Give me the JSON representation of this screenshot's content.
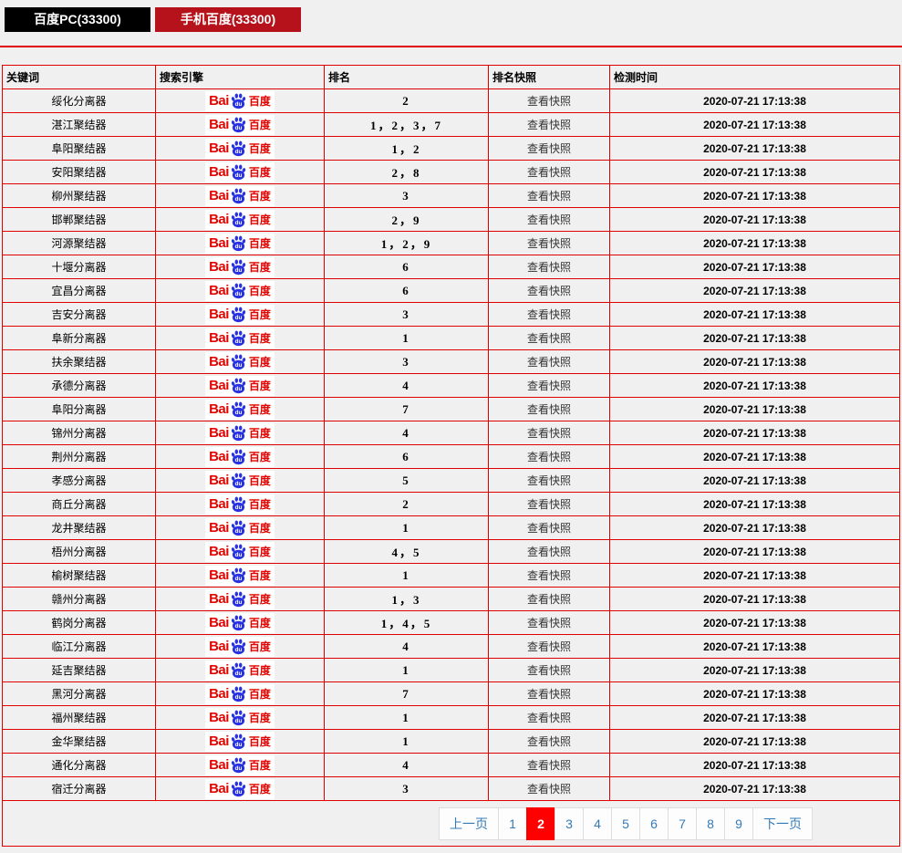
{
  "tabs": [
    {
      "label": "百度PC(33300)"
    },
    {
      "label": "手机百度(33300)"
    }
  ],
  "table": {
    "headers": [
      "关键词",
      "搜索引擎",
      "排名",
      "排名快照",
      "检测时间"
    ],
    "engine_logo": {
      "bai": "Bai",
      "du": "du",
      "cn": "百度"
    },
    "snapshot_label": "查看快照",
    "rows": [
      {
        "keyword": "绥化分离器",
        "rank": "2",
        "time": "2020-07-21 17:13:38"
      },
      {
        "keyword": "湛江聚结器",
        "rank": "1，2，3，7",
        "time": "2020-07-21 17:13:38"
      },
      {
        "keyword": "阜阳聚结器",
        "rank": "1，2",
        "time": "2020-07-21 17:13:38"
      },
      {
        "keyword": "安阳聚结器",
        "rank": "2，8",
        "time": "2020-07-21 17:13:38"
      },
      {
        "keyword": "柳州聚结器",
        "rank": "3",
        "time": "2020-07-21 17:13:38"
      },
      {
        "keyword": "邯郸聚结器",
        "rank": "2，9",
        "time": "2020-07-21 17:13:38"
      },
      {
        "keyword": "河源聚结器",
        "rank": "1，2，9",
        "time": "2020-07-21 17:13:38"
      },
      {
        "keyword": "十堰分离器",
        "rank": "6",
        "time": "2020-07-21 17:13:38"
      },
      {
        "keyword": "宜昌分离器",
        "rank": "6",
        "time": "2020-07-21 17:13:38"
      },
      {
        "keyword": "吉安分离器",
        "rank": "3",
        "time": "2020-07-21 17:13:38"
      },
      {
        "keyword": "阜新分离器",
        "rank": "1",
        "time": "2020-07-21 17:13:38"
      },
      {
        "keyword": "扶余聚结器",
        "rank": "3",
        "time": "2020-07-21 17:13:38"
      },
      {
        "keyword": "承德分离器",
        "rank": "4",
        "time": "2020-07-21 17:13:38"
      },
      {
        "keyword": "阜阳分离器",
        "rank": "7",
        "time": "2020-07-21 17:13:38"
      },
      {
        "keyword": "锦州分离器",
        "rank": "4",
        "time": "2020-07-21 17:13:38"
      },
      {
        "keyword": "荆州分离器",
        "rank": "6",
        "time": "2020-07-21 17:13:38"
      },
      {
        "keyword": "孝感分离器",
        "rank": "5",
        "time": "2020-07-21 17:13:38"
      },
      {
        "keyword": "商丘分离器",
        "rank": "2",
        "time": "2020-07-21 17:13:38"
      },
      {
        "keyword": "龙井聚结器",
        "rank": "1",
        "time": "2020-07-21 17:13:38"
      },
      {
        "keyword": "梧州分离器",
        "rank": "4，5",
        "time": "2020-07-21 17:13:38"
      },
      {
        "keyword": "榆树聚结器",
        "rank": "1",
        "time": "2020-07-21 17:13:38"
      },
      {
        "keyword": "赣州分离器",
        "rank": "1，3",
        "time": "2020-07-21 17:13:38"
      },
      {
        "keyword": "鹤岗分离器",
        "rank": "1，4，5",
        "time": "2020-07-21 17:13:38"
      },
      {
        "keyword": "临江分离器",
        "rank": "4",
        "time": "2020-07-21 17:13:38"
      },
      {
        "keyword": "延吉聚结器",
        "rank": "1",
        "time": "2020-07-21 17:13:38"
      },
      {
        "keyword": "黑河分离器",
        "rank": "7",
        "time": "2020-07-21 17:13:38"
      },
      {
        "keyword": "福州聚结器",
        "rank": "1",
        "time": "2020-07-21 17:13:38"
      },
      {
        "keyword": "金华聚结器",
        "rank": "1",
        "time": "2020-07-21 17:13:38"
      },
      {
        "keyword": "通化分离器",
        "rank": "4",
        "time": "2020-07-21 17:13:38"
      },
      {
        "keyword": "宿迁分离器",
        "rank": "3",
        "time": "2020-07-21 17:13:38"
      }
    ]
  },
  "pagination": {
    "prev": "上一页",
    "next": "下一页",
    "pages": [
      "1",
      "2",
      "3",
      "4",
      "5",
      "6",
      "7",
      "8",
      "9"
    ],
    "active": "2"
  },
  "colors": {
    "table_border_red": "#e10000",
    "tab_black": "#000000",
    "tab_red": "#b5121b",
    "active_page_red": "#fe0000",
    "link_blue": "#337ab7",
    "baidu_red": "#e10601",
    "baidu_blue": "#2932e1",
    "page_bg": "#f0f0f0"
  }
}
